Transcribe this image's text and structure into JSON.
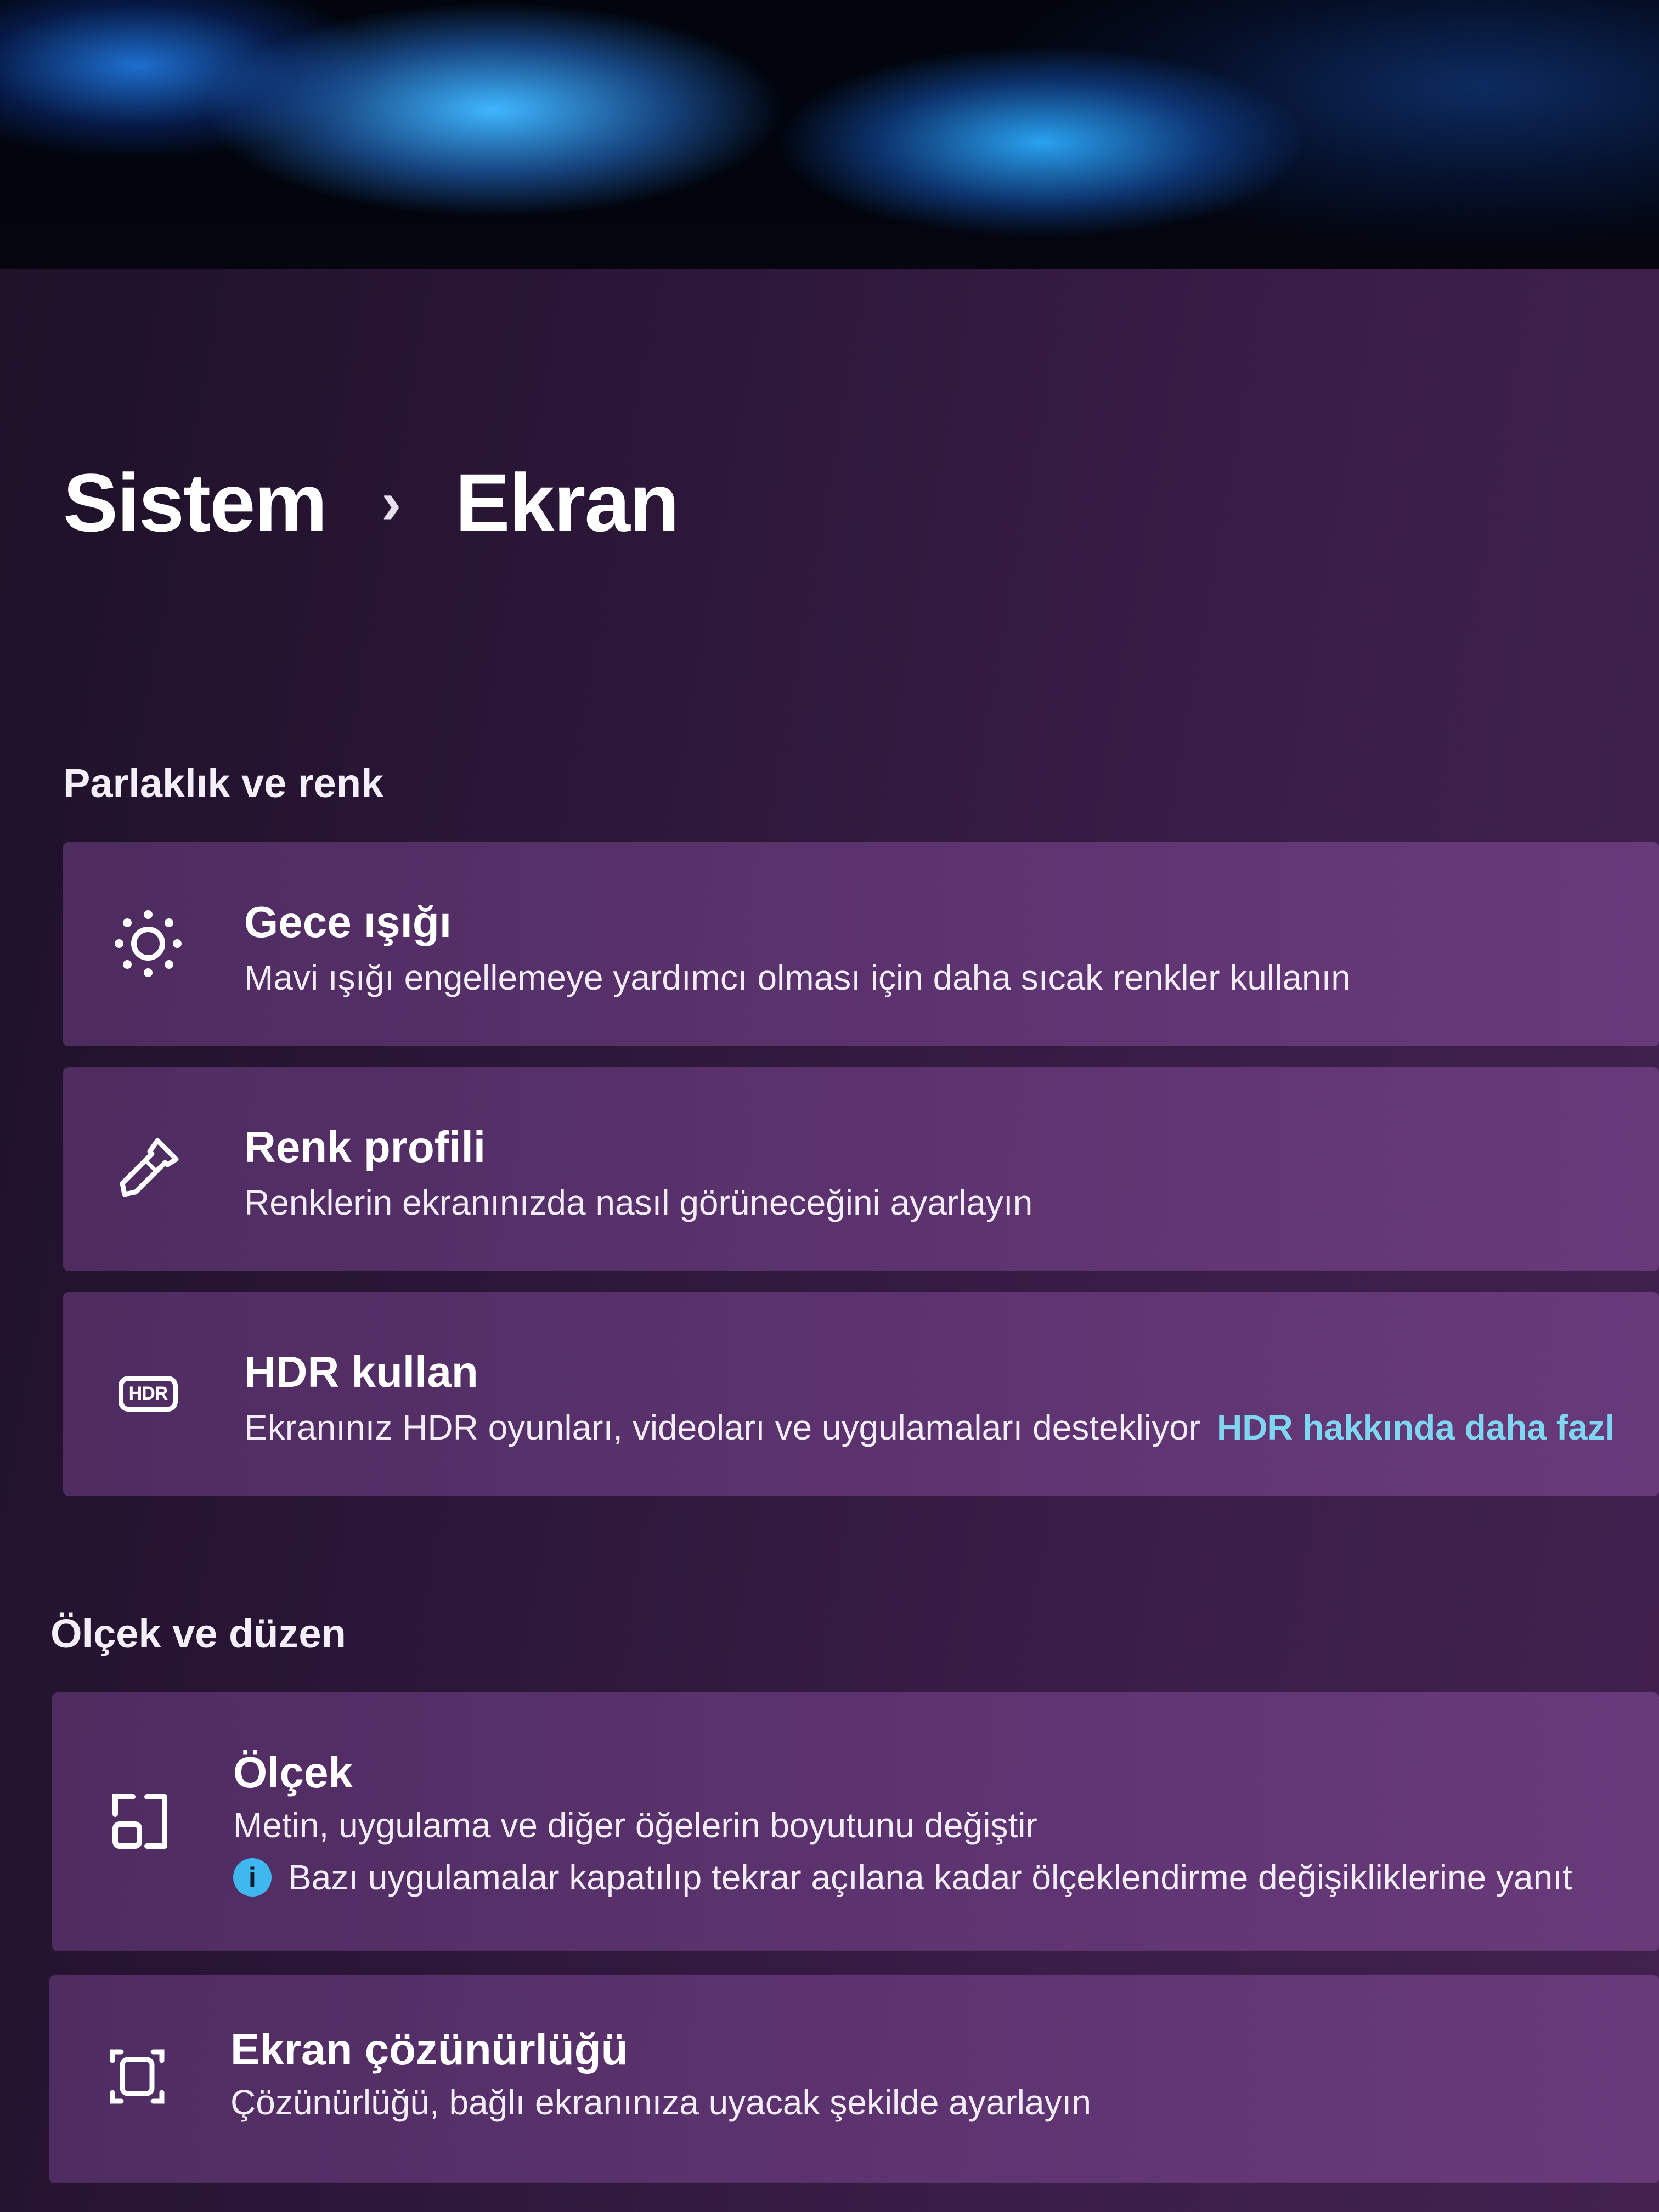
{
  "breadcrumb": {
    "parent": "Sistem",
    "separator": "›",
    "current": "Ekran"
  },
  "sections": {
    "brightness": {
      "title": "Parlaklık ve renk",
      "items": [
        {
          "icon": "brightness-sun-icon",
          "title": "Gece ışığı",
          "description": "Mavi ışığı engellemeye yardımcı olması için daha sıcak renkler kullanın"
        },
        {
          "icon": "color-dropper-icon",
          "title": "Renk profili",
          "description": "Renklerin ekranınızda nasıl görüneceğini ayarlayın"
        },
        {
          "icon": "hdr-icon",
          "title": "HDR kullan",
          "description": "Ekranınız HDR oyunları, videoları ve uygulamaları destekliyor",
          "link": "HDR hakkında daha fazl"
        }
      ]
    },
    "scale": {
      "title": "Ölçek ve düzen",
      "items": [
        {
          "icon": "scale-icon",
          "title": "Ölçek",
          "description": "Metin, uygulama ve diğer öğelerin boyutunu değiştir",
          "info": "Bazı uygulamalar kapatılıp tekrar açılana kadar ölçeklendirme değişikliklerine yanıt"
        },
        {
          "icon": "resolution-icon",
          "title": "Ekran çözünürlüğü",
          "description": "Çözünürlüğü, bağlı ekranınıza uyacak şekilde ayarlayın"
        }
      ]
    }
  },
  "hdr_icon_label": "HDR",
  "info_glyph": "i",
  "colors": {
    "link": "#7fd6f0",
    "info": "#3fb8f0",
    "card": "#683a7c"
  }
}
